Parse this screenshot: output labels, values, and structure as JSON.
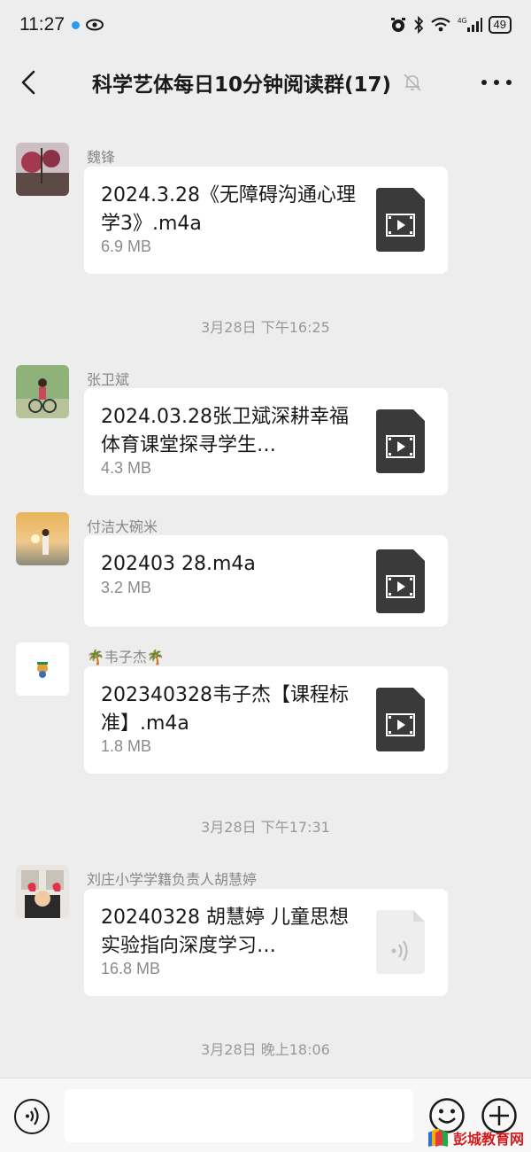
{
  "status_bar": {
    "time": "11:27",
    "battery": "49",
    "network": "4G",
    "accent_dot_color": "#2a9af3"
  },
  "nav": {
    "title": "科学艺体每日10分钟阅读群(17)",
    "back_icon": "back-chevron-icon",
    "mute_icon": "muted-bell-icon",
    "more_icon": "more-dots-icon"
  },
  "messages": [
    {
      "sender": "魏锋",
      "file_name": "2024.3.28《无障碍沟通心理学3》.m4a",
      "file_size": "6.9 MB",
      "icon": "video-file-icon"
    },
    {
      "sender": "张卫斌",
      "file_name": "2024.03.28张卫斌深耕幸福体育课堂探寻学生…",
      "file_size": "4.3 MB",
      "icon": "video-file-icon"
    },
    {
      "sender": "付洁大碗米",
      "file_name": "202403 28.m4a",
      "file_size": "3.2 MB",
      "icon": "video-file-icon"
    },
    {
      "sender": "🌴韦子杰🌴",
      "file_name": "202340328韦子杰【课程标准】.m4a",
      "file_size": "1.8 MB",
      "icon": "video-file-icon"
    },
    {
      "sender": "刘庄小学学籍负责人胡慧婷",
      "file_name": "20240328 胡慧婷 儿童思想实验指向深度学习…",
      "file_size": "16.8 MB",
      "icon": "audio-file-icon"
    }
  ],
  "timestamps": [
    "3月28日 下午16:25",
    "3月28日 下午17:31",
    "3月28日 晚上18:06"
  ],
  "input_bar": {
    "voice_icon": "voice-input-icon",
    "emoji_icon": "emoji-icon",
    "plus_icon": "plus-icon",
    "text_value": ""
  },
  "watermark": {
    "text": "彭城教育网",
    "color": "#d31d1d"
  }
}
